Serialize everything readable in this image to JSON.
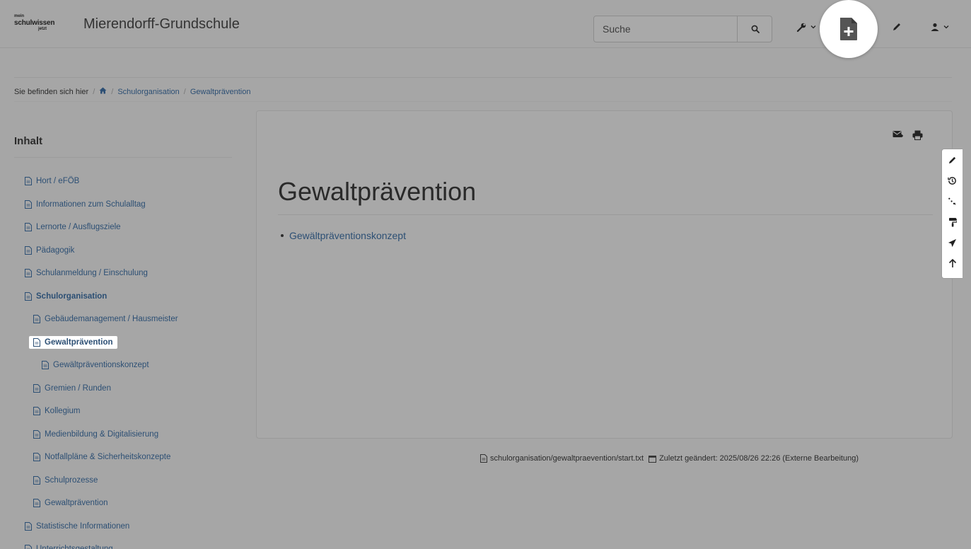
{
  "header": {
    "logo": {
      "top": "mein",
      "mid": "schulwissen",
      "bottom": "jetzt"
    },
    "site_title": "Mierendorff-Grundschule",
    "search_placeholder": "Suche",
    "icons": [
      "search-icon",
      "wrench-icon",
      "new-page-icon",
      "pencil-icon",
      "user-icon"
    ]
  },
  "breadcrumb": {
    "prefix": "Sie befinden sich hier",
    "items": [
      "Schulorganisation",
      "Gewaltprävention"
    ]
  },
  "sidebar": {
    "title": "Inhalt",
    "items": [
      {
        "label": "Hort / eFÖB",
        "level": 0
      },
      {
        "label": "Informationen zum Schulalltag",
        "level": 0
      },
      {
        "label": "Lernorte / Ausflugsziele",
        "level": 0
      },
      {
        "label": "Pädagogik",
        "level": 0
      },
      {
        "label": "Schulanmeldung / Einschulung",
        "level": 0
      },
      {
        "label": "Schulorganisation",
        "level": 0,
        "bold": true
      },
      {
        "label": "Gebäudemanagement / Hausmeister",
        "level": 1
      },
      {
        "label": "Gewaltprävention",
        "level": 1,
        "bold": true,
        "current": true
      },
      {
        "label": "Gewältpräventionskonzept",
        "level": 2
      },
      {
        "label": "Gremien / Runden",
        "level": 1
      },
      {
        "label": "Kollegium",
        "level": 1
      },
      {
        "label": "Medienbildung & Digitalisierung",
        "level": 1
      },
      {
        "label": "Notfallpläne & Sicherheitskonzepte",
        "level": 1
      },
      {
        "label": "Schulprozesse",
        "level": 1
      },
      {
        "label": "Gewaltprävention",
        "level": 1
      },
      {
        "label": "Statistische Informationen",
        "level": 0
      },
      {
        "label": "Unterrichtsgestaltung",
        "level": 0
      }
    ]
  },
  "main": {
    "title": "Gewaltprävention",
    "links": [
      "Gewältpräventionskonzept"
    ],
    "card_tools": [
      "mail-icon",
      "print-icon"
    ]
  },
  "page_tools": [
    "pencil-icon",
    "history-icon",
    "backlinks-icon",
    "paint-roller-icon",
    "send-icon",
    "arrow-up-icon"
  ],
  "doc_info": {
    "path": "schulorganisation/gewaltpraevention/start.txt",
    "modified_label": "Zuletzt geändert: 2025/08/26 22:26 (Externe Bearbeitung)"
  },
  "colors": {
    "background": "#a6a6a6",
    "link": "#2c4f74",
    "highlight": "#ffffff"
  }
}
